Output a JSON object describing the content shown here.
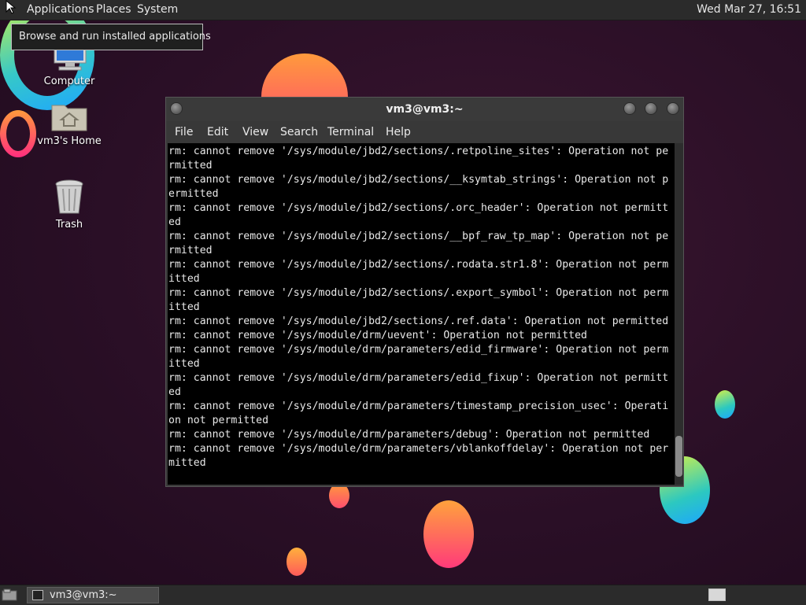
{
  "top_panel": {
    "applications": "Applications",
    "places": "Places",
    "system": "System",
    "clock": "Wed Mar 27, 16:51"
  },
  "tooltip": "Browse and run installed applications",
  "desktop": {
    "icons": [
      {
        "label": "Computer",
        "icon": "computer-icon"
      },
      {
        "label": "vm3's Home",
        "icon": "home-folder-icon"
      },
      {
        "label": "Trash",
        "icon": "trash-icon"
      }
    ]
  },
  "terminal": {
    "title": "vm3@vm3:~",
    "menu": [
      "File",
      "Edit",
      "View",
      "Search",
      "Terminal",
      "Help"
    ],
    "lines": [
      "rm: cannot remove '/sys/module/jbd2/sections/.retpoline_sites': Operation not pe",
      "rmitted",
      "rm: cannot remove '/sys/module/jbd2/sections/__ksymtab_strings': Operation not p",
      "ermitted",
      "rm: cannot remove '/sys/module/jbd2/sections/.orc_header': Operation not permitt",
      "ed",
      "rm: cannot remove '/sys/module/jbd2/sections/__bpf_raw_tp_map': Operation not pe",
      "rmitted",
      "rm: cannot remove '/sys/module/jbd2/sections/.rodata.str1.8': Operation not perm",
      "itted",
      "rm: cannot remove '/sys/module/jbd2/sections/.export_symbol': Operation not perm",
      "itted",
      "rm: cannot remove '/sys/module/jbd2/sections/.ref.data': Operation not permitted",
      "rm: cannot remove '/sys/module/drm/uevent': Operation not permitted",
      "rm: cannot remove '/sys/module/drm/parameters/edid_firmware': Operation not perm",
      "itted",
      "rm: cannot remove '/sys/module/drm/parameters/edid_fixup': Operation not permitt",
      "ed",
      "rm: cannot remove '/sys/module/drm/parameters/timestamp_precision_usec': Operati",
      "on not permitted",
      "rm: cannot remove '/sys/module/drm/parameters/debug': Operation not permitted",
      "rm: cannot remove '/sys/module/drm/parameters/vblankoffdelay': Operation not per",
      "mitted"
    ]
  },
  "bottom_panel": {
    "task_label": "vm3@vm3:~"
  }
}
